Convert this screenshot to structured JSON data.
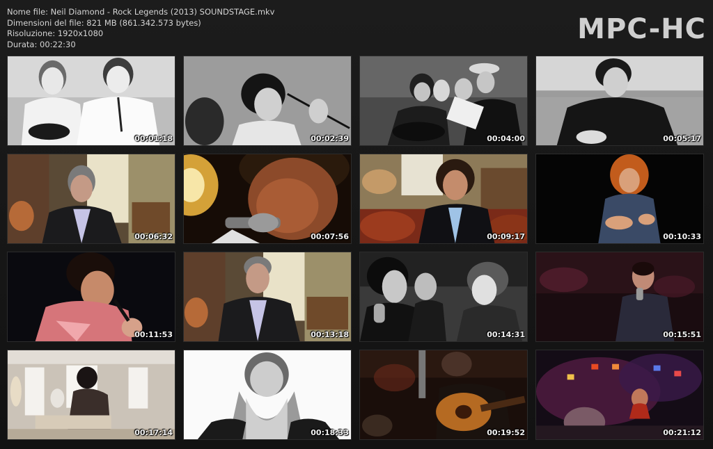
{
  "info": {
    "file_name": "Nome file: Neil Diamond - Rock Legends (2013) SOUNDSTAGE.mkv",
    "file_size": "Dimensioni del file: 821 MB (861.342.573 bytes)",
    "resolution": "Risoluzione: 1920x1080",
    "duration": "Durata: 00:22:30"
  },
  "logo": "MPC-HC",
  "thumbnails": [
    {
      "time": "00:01:18"
    },
    {
      "time": "00:02:39"
    },
    {
      "time": "00:04:00"
    },
    {
      "time": "00:05:17"
    },
    {
      "time": "00:06:32"
    },
    {
      "time": "00:07:56"
    },
    {
      "time": "00:09:17"
    },
    {
      "time": "00:10:33"
    },
    {
      "time": "00:11:53"
    },
    {
      "time": "00:13:18"
    },
    {
      "time": "00:14:31"
    },
    {
      "time": "00:15:51"
    },
    {
      "time": "00:17:14"
    },
    {
      "time": "00:18:33"
    },
    {
      "time": "00:19:52"
    },
    {
      "time": "00:21:12"
    }
  ]
}
